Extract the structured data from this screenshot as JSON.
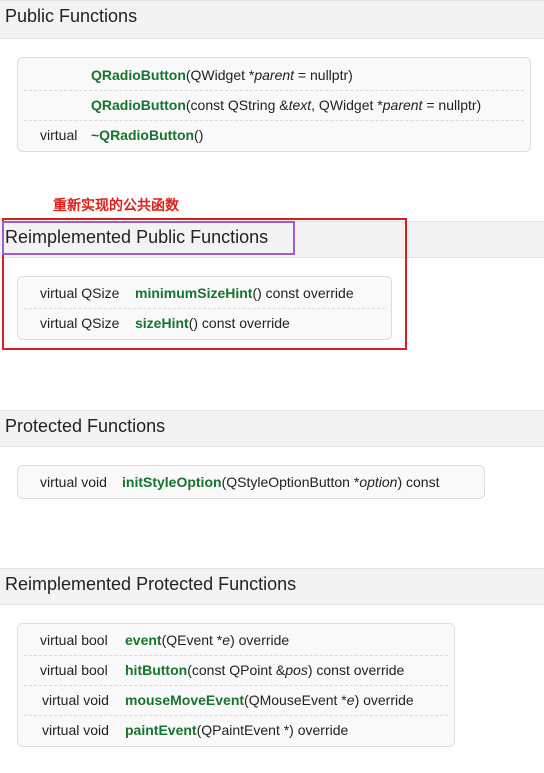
{
  "public_functions": {
    "title": "Public Functions",
    "rows": [
      {
        "type": "",
        "name": "QRadioButton",
        "p1": "(QWidget *",
        "a1": "parent",
        "p2": " = nullptr)",
        "a2": "",
        "p3": "",
        "a3": "",
        "p4": ""
      },
      {
        "type": "",
        "name": "QRadioButton",
        "p1": "(const QString &",
        "a1": "text",
        "p2": ", QWidget *",
        "a2": "parent",
        "p3": " = nullptr)",
        "a3": "",
        "p4": ""
      },
      {
        "type": "virtual",
        "name": "~QRadioButton",
        "p1": "()",
        "a1": "",
        "p2": "",
        "a2": "",
        "p3": "",
        "a3": "",
        "p4": ""
      }
    ]
  },
  "annotation": "重新实现的公共函数",
  "reimplemented_public": {
    "title": "Reimplemented Public Functions",
    "rows": [
      {
        "type": "virtual QSize",
        "name": "minimumSizeHint",
        "p1": "() const override"
      },
      {
        "type": "virtual QSize",
        "name": "sizeHint",
        "p1": "() const override"
      }
    ]
  },
  "protected_functions": {
    "title": "Protected Functions",
    "rows": [
      {
        "type": "virtual void",
        "name": "initStyleOption",
        "p1": "(QStyleOptionButton *",
        "a1": "option",
        "p2": ") const"
      }
    ]
  },
  "reimplemented_protected": {
    "title": "Reimplemented Protected Functions",
    "rows": [
      {
        "type": "virtual bool",
        "name": "event",
        "p1": "(QEvent *",
        "a1": "e",
        "p2": ") override"
      },
      {
        "type": "virtual bool",
        "name": "hitButton",
        "p1": "(const QPoint &",
        "a1": "pos",
        "p2": ") const override"
      },
      {
        "type": "virtual void",
        "name": "mouseMoveEvent",
        "p1": "(QMouseEvent *",
        "a1": "e",
        "p2": ") override"
      },
      {
        "type": "virtual void",
        "name": "paintEvent",
        "p1": "(QPaintEvent *) override",
        "a1": "",
        "p2": ""
      }
    ]
  },
  "colors": {
    "function_link": "#17742c",
    "annotation_red": "#e0201a",
    "highlight_purple": "#a25bc7"
  }
}
